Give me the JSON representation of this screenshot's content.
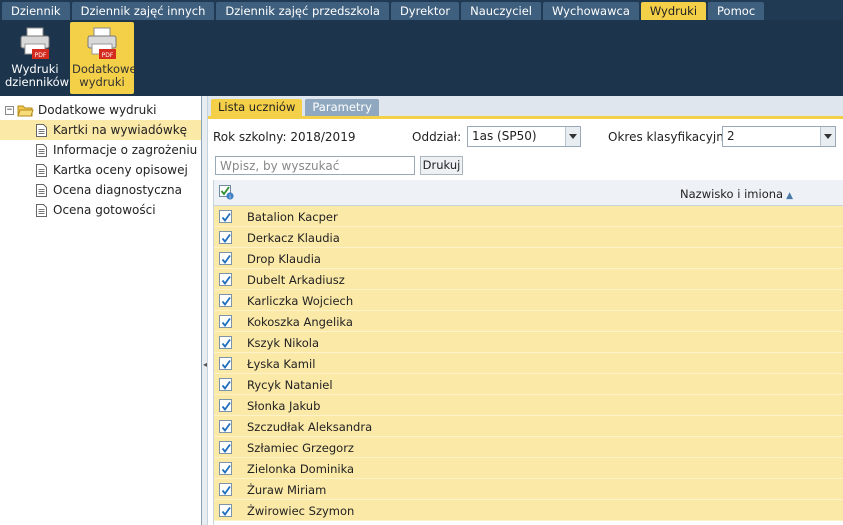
{
  "menu": {
    "tabs": [
      {
        "label": "Dziennik"
      },
      {
        "label": "Dziennik zajęć innych"
      },
      {
        "label": "Dziennik zajęć przedszkola"
      },
      {
        "label": "Dyrektor"
      },
      {
        "label": "Nauczyciel"
      },
      {
        "label": "Wychowawca"
      },
      {
        "label": "Wydruki"
      },
      {
        "label": "Pomoc"
      }
    ],
    "active": "Wydruki"
  },
  "toolbar": {
    "buttons": [
      {
        "label": "Wydruki dzienników",
        "icon": "pdf-printer-icon"
      },
      {
        "label": "Dodatkowe wydruki",
        "icon": "pdf-printer-icon"
      }
    ],
    "pdf_badge": "PDF"
  },
  "tree": {
    "root_label": "Dodatkowe wydruki",
    "items": [
      {
        "label": "Kartki na wywiadówkę",
        "selected": true
      },
      {
        "label": "Informacje o zagrożeniu"
      },
      {
        "label": "Kartka oceny opisowej"
      },
      {
        "label": "Ocena diagnostyczna"
      },
      {
        "label": "Ocena gotowości"
      }
    ]
  },
  "subtabs": [
    {
      "label": "Lista uczniów"
    },
    {
      "label": "Parametry"
    }
  ],
  "filters": {
    "school_year": "Rok szkolny: 2018/2019",
    "class_label": "Oddział:",
    "class_value": "1as (SP50)",
    "period_label": "Okres klasyfikacyjny:",
    "period_value": "2"
  },
  "search": {
    "placeholder": "Wpisz, by wyszukać",
    "print_label": "Drukuj"
  },
  "grid": {
    "column_title": "Nazwisko i imiona",
    "rows": [
      "Batalion Kacper",
      "Derkacz Klaudia",
      "Drop Klaudia",
      "Dubelt Arkadiusz",
      "Karliczka Wojciech",
      "Kokoszka Angelika",
      "Kszyk Nikola",
      "Łyska Kamil",
      "Rycyk Nataniel",
      "Słonka Jakub",
      "Szczudłak Aleksandra",
      "Szłamiec Grzegorz",
      "Zielonka Dominika",
      "Żuraw Miriam",
      "Żwirowiec Szymon"
    ]
  },
  "colors": {
    "accent": "#f4cf48",
    "nav": "#1f3a52",
    "row": "#fbe9a8"
  }
}
